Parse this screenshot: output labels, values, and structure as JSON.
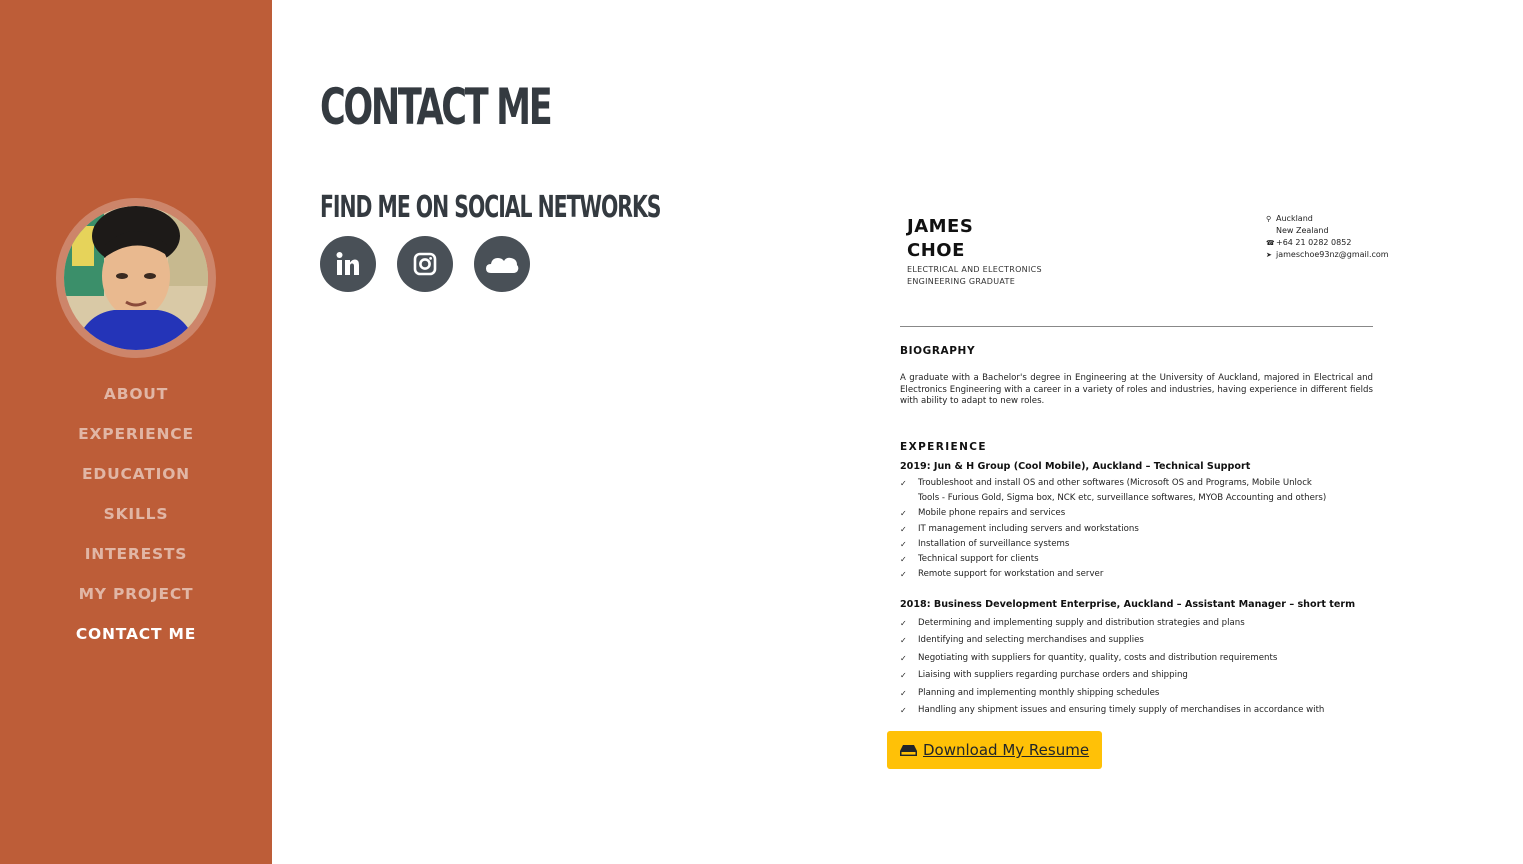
{
  "sidebar": {
    "bg_color": "#bd5d38",
    "avatar_alt": "profile photo",
    "nav": [
      {
        "label": "ABOUT",
        "active": false
      },
      {
        "label": "EXPERIENCE",
        "active": false
      },
      {
        "label": "EDUCATION",
        "active": false
      },
      {
        "label": "SKILLS",
        "active": false
      },
      {
        "label": "INTERESTS",
        "active": false
      },
      {
        "label": "MY PROJECT",
        "active": false
      },
      {
        "label": "CONTACT ME",
        "active": true
      }
    ]
  },
  "main": {
    "title": "CONTACT ME",
    "social_heading": "FIND ME ON SOCIAL NETWORKS",
    "socials": [
      {
        "icon": "linkedin-icon"
      },
      {
        "icon": "instagram-icon"
      },
      {
        "icon": "soundcloud-icon"
      }
    ],
    "download_button": {
      "label": "Download My Resume",
      "icon": "hdd-icon",
      "color": "#ffc107"
    }
  },
  "resume": {
    "name_line1": "JAMES",
    "name_line2": "CHOE",
    "role_line1": "ELECTRICAL AND ELECTRONICS",
    "role_line2": "ENGINEERING GRADUATE",
    "location_line1": "Auckland",
    "location_line2": "New Zealand",
    "phone": "+64 21 0282 0852",
    "email": "jameschoe93nz@gmail.com",
    "bio_heading": "BIOGRAPHY",
    "bio_text": "A graduate with a Bachelor's degree in Engineering at the University of Auckland, majored in Electrical and Electronics Engineering with a career in a variety of roles and industries, having experience in different fields with ability to adapt to new roles.",
    "exp_heading": "EXPERIENCE",
    "job1_title": "2019: Jun & H Group (Cool Mobile), Auckland – Technical Support",
    "job1_items": [
      "Troubleshoot and install OS and other softwares (Microsoft OS and Programs, Mobile Unlock",
      "Tools - Furious Gold, Sigma box, NCK etc, surveillance softwares, MYOB Accounting and others)",
      "Mobile phone repairs and services",
      "IT management including servers and workstations",
      "Installation of surveillance systems",
      "Technical support for clients",
      "Remote support for workstation and server"
    ],
    "job2_title": "2018: Business Development Enterprise, Auckland – Assistant Manager – short term",
    "job2_items": [
      "Determining and implementing supply and distribution strategies and plans",
      "Identifying and selecting merchandises and supplies",
      "Negotiating with suppliers for quantity, quality, costs and distribution requirements",
      "Liaising with suppliers regarding purchase orders and shipping",
      "Planning and implementing monthly shipping schedules",
      "Handling any shipment issues and ensuring timely supply of merchandises in accordance with"
    ]
  }
}
